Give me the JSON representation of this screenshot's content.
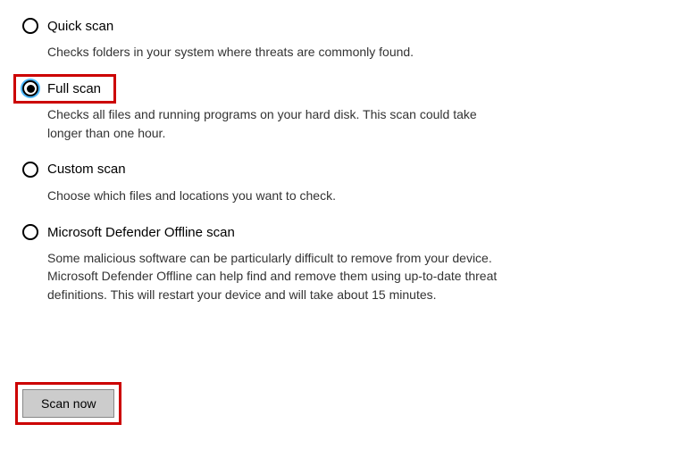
{
  "options": {
    "quick": {
      "label": "Quick scan",
      "desc": "Checks folders in your system where threats are commonly found."
    },
    "full": {
      "label": "Full scan",
      "desc": "Checks all files and running programs on your hard disk. This scan could take longer than one hour."
    },
    "custom": {
      "label": "Custom scan",
      "desc": "Choose which files and locations you want to check."
    },
    "offline": {
      "label": "Microsoft Defender Offline scan",
      "desc": "Some malicious software can be particularly difficult to remove from your device. Microsoft Defender Offline can help find and remove them using up-to-date threat definitions. This will restart your device and will take about 15 minutes."
    }
  },
  "button": {
    "scan_now": "Scan now"
  }
}
